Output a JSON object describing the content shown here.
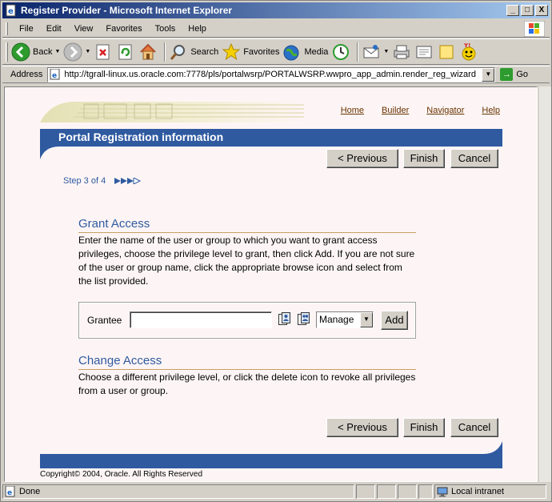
{
  "window": {
    "title": "Register Provider - Microsoft Internet Explorer",
    "controls": {
      "minimize": "_",
      "maximize": "□",
      "close": "X"
    }
  },
  "menubar": {
    "items": [
      "File",
      "Edit",
      "View",
      "Favorites",
      "Tools",
      "Help"
    ]
  },
  "toolbar": {
    "back": "Back",
    "search": "Search",
    "favorites": "Favorites",
    "media": "Media"
  },
  "addressbar": {
    "label": "Address",
    "url": "http://tgrall-linux.us.oracle.com:7778/pls/portalwsrp/PORTALWSRP.wwpro_app_admin.render_reg_wizard",
    "go": "Go"
  },
  "portal": {
    "links": {
      "home": "Home",
      "builder": "Builder",
      "navigator": "Navigator",
      "help": "Help"
    },
    "banner_title": "Portal Registration information",
    "buttons": {
      "previous": "< Previous",
      "finish": "Finish",
      "cancel": "Cancel"
    },
    "step": "Step 3 of 4",
    "grant": {
      "title": "Grant Access",
      "text": "Enter the name of the user or group to which you want to grant access privileges, choose the privilege level to grant, then click Add. If you are not sure of the user or group name, click the appropriate browse icon and select from the list provided.",
      "grantee_label": "Grantee",
      "grantee_value": "",
      "privilege_selected": "Manage",
      "add": "Add"
    },
    "change": {
      "title": "Change Access",
      "text": "Choose a different privilege level, or click the delete icon to revoke all privileges from a user or group."
    },
    "copyright": "Copyright© 2004, Oracle. All Rights Reserved"
  },
  "statusbar": {
    "status": "Done",
    "zone": "Local intranet"
  },
  "colors": {
    "banner": "#2f5aa0",
    "page_bg": "#fdf5f5",
    "section_title": "#2f5aa0",
    "link": "#663300"
  }
}
